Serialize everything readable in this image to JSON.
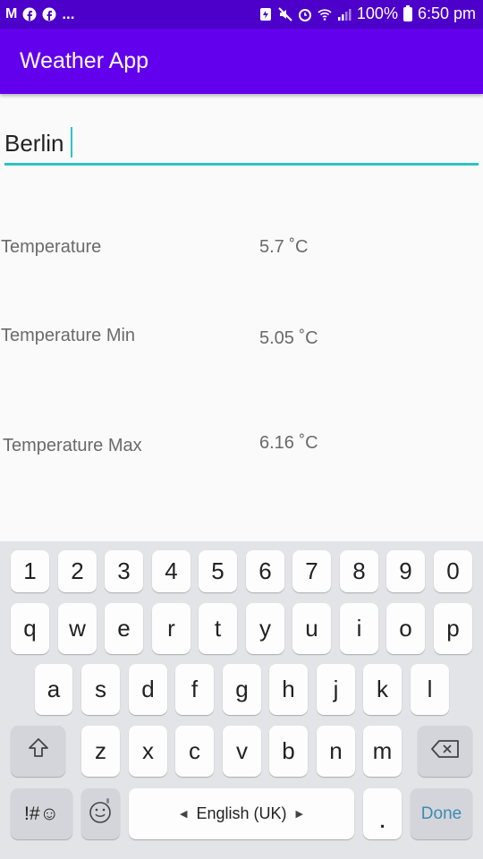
{
  "status_bar": {
    "left_icons": [
      "gmail-icon",
      "facebook-icon",
      "facebook-icon"
    ],
    "overflow": "...",
    "battery_percent": "100%",
    "time": "6:50 pm"
  },
  "app_bar": {
    "title": "Weather App"
  },
  "city_input": {
    "value": "Berlin"
  },
  "readings": [
    {
      "label": "Temperature",
      "value": "5.7 ˚C"
    },
    {
      "label": "Temperature Min",
      "value": "5.05 ˚C"
    },
    {
      "label": "Temperature Max",
      "value": "6.16 ˚C"
    }
  ],
  "keyboard": {
    "number_row": [
      "1",
      "2",
      "3",
      "4",
      "5",
      "6",
      "7",
      "8",
      "9",
      "0"
    ],
    "row1": [
      "q",
      "w",
      "e",
      "r",
      "t",
      "y",
      "u",
      "i",
      "o",
      "p"
    ],
    "row2": [
      "a",
      "s",
      "d",
      "f",
      "g",
      "h",
      "j",
      "k",
      "l"
    ],
    "row3": [
      "z",
      "x",
      "c",
      "v",
      "b",
      "n",
      "m"
    ],
    "symbols_key": "!#☺",
    "space_label": "English (UK)",
    "period_key": ".",
    "done_key": "Done"
  },
  "colors": {
    "status_bar": "#4c00c9",
    "app_bar": "#6200ee",
    "input_underline": "#2ac4c2",
    "done_text": "#3d8bb3"
  }
}
